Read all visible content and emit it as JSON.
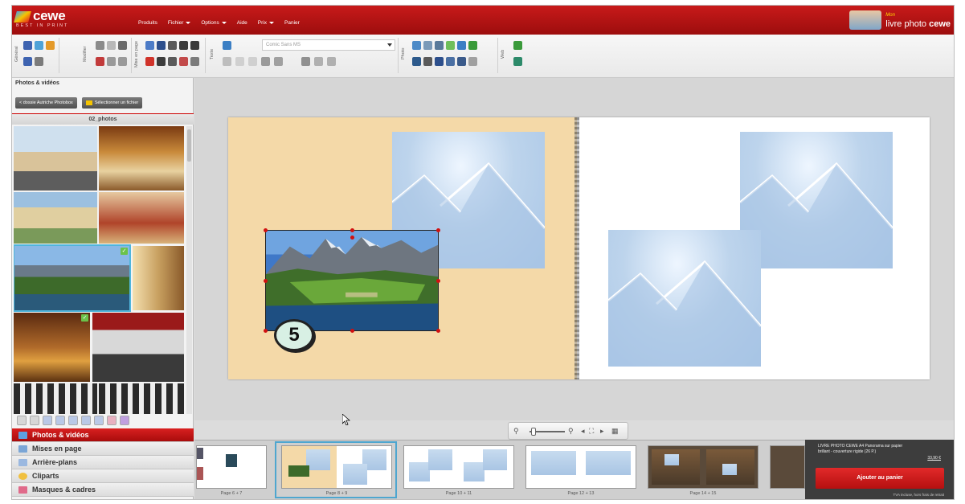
{
  "topbar": {
    "logo_name": "cewe",
    "logo_tag": "BEST IN PRINT",
    "menu": [
      "Produits",
      "Fichier",
      "Options",
      "Aide",
      "Prix",
      "Panier"
    ],
    "brand_small": "Mon",
    "brand_main": "livre photo",
    "brand_bold": "cewe"
  },
  "toolbar": {
    "groups": [
      "Général",
      "Modifier",
      "Mise en page",
      "Texte",
      "Photo",
      "Web"
    ],
    "font_name": "Comic Sans MS"
  },
  "sidebar": {
    "title": "Photos & vidéos",
    "back_button": "< dossie Autriche Photobox",
    "select_file_button": "Sélectionner un fichier",
    "folder_name": "02_photos",
    "nav": [
      {
        "label": "Photos & vidéos",
        "icon": "photo-icon",
        "active": true
      },
      {
        "label": "Mises en page",
        "icon": "layout-icon",
        "active": false
      },
      {
        "label": "Arrière-plans",
        "icon": "background-icon",
        "active": false
      },
      {
        "label": "Cliparts",
        "icon": "clipart-icon",
        "active": false
      },
      {
        "label": "Masques & cadres",
        "icon": "mask-icon",
        "active": false
      }
    ]
  },
  "canvas": {
    "badge": "5"
  },
  "filmstrip": {
    "pages": [
      "Page 6 + 7",
      "Page 8 + 9",
      "Page 10 + 11",
      "Page 12 + 13",
      "Page 14 + 15"
    ],
    "selected_index": 1
  },
  "cart": {
    "description": "LIVRE PHOTO CEWE A4 Panorama sur papier brillant - couverture rigide  (26 P.)",
    "price": "33,90 €",
    "add_button": "Ajouter au panier",
    "vat_note": "TVA incluse, hors frais de retrait"
  },
  "colors": {
    "brand_red": "#b81414",
    "selection_blue": "#4ea6cf",
    "page_beige": "#f4d9a8",
    "placeholder_blue": "#b2cce8"
  }
}
